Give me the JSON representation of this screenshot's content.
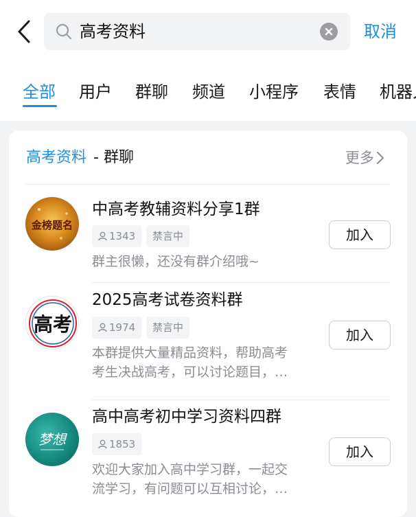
{
  "search": {
    "query": "高考资料",
    "cancel_label": "取消"
  },
  "tabs": [
    {
      "label": "全部",
      "active": true
    },
    {
      "label": "用户"
    },
    {
      "label": "群聊"
    },
    {
      "label": "频道"
    },
    {
      "label": "小程序"
    },
    {
      "label": "表情"
    },
    {
      "label": "机器人"
    }
  ],
  "section": {
    "keyword": "高考资料",
    "category": "- 群聊",
    "more_label": "更多"
  },
  "groups": [
    {
      "name": "中高考教辅资料分享1群",
      "member_count": "1343",
      "status_tag": "禁言中",
      "description": "群主很懒，还没有群介绍哦~",
      "avatar_text": "金榜题名",
      "join_label": "加入"
    },
    {
      "name": "2025高考试卷资料群",
      "member_count": "1974",
      "status_tag": "禁言中",
      "description_line1": "本群提供大量精品资料，帮助高考",
      "description_line2": "考生决战高考，可以讨论题目，…",
      "avatar_text": "高考",
      "join_label": "加入"
    },
    {
      "name": "高中高考初中学习资料四群",
      "member_count": "1853",
      "description_line1": "欢迎大家加入高中学习群，一起交",
      "description_line2": "流学习，有问题可以互相讨论，…",
      "avatar_text": "梦想",
      "join_label": "加入"
    }
  ],
  "colors": {
    "accent": "#1e8fe0",
    "muted": "#8a8d93",
    "background": "#f2f3f5"
  }
}
